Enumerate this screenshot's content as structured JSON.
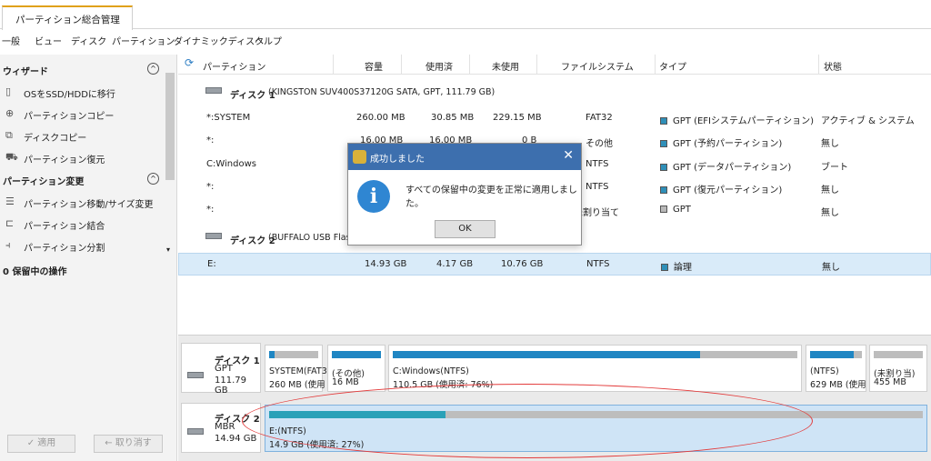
{
  "app_tab": "パーティション総合管理",
  "menu": [
    "一般",
    "ビュー",
    "ディスク",
    "パーティション",
    "ダイナミックディスク",
    "ヘルプ"
  ],
  "sidebar": {
    "wizard_title": "ウィザード",
    "wizard_items": [
      "OSをSSD/HDDに移行",
      "パーティションコピー",
      "ディスクコピー",
      "パーティション復元"
    ],
    "partition_title": "パーティション変更",
    "partition_items": [
      "パーティション移動/サイズ変更",
      "パーティション結合",
      "パーティション分割"
    ],
    "pending": "0 保留中の操作",
    "apply": "✓ 適用",
    "undo": "← 取り消す"
  },
  "table": {
    "headers": [
      "パーティション",
      "容量",
      "使用済",
      "未使用",
      "ファイルシステム",
      "タイプ",
      "状態"
    ],
    "disk1_label": "ディスク 1",
    "disk1_info": "(KINGSTON SUV400S37120G SATA, GPT, 111.79 GB)",
    "disk1_rows": [
      {
        "name": "*:SYSTEM",
        "size": "260.00 MB",
        "used": "30.85 MB",
        "free": "229.15 MB",
        "fs": "FAT32",
        "type": "GPT (EFIシステムパーティション)",
        "status": "アクティブ & システム"
      },
      {
        "name": "*:",
        "size": "16.00 MB",
        "used": "16.00 MB",
        "free": "0 B",
        "fs": "その他",
        "type": "GPT (予約パーティション)",
        "status": "無し"
      },
      {
        "name": "C:Windows",
        "size": "",
        "used": "",
        "free": "",
        "fs": "NTFS",
        "type": "GPT (データパーティション)",
        "status": "ブート"
      },
      {
        "name": "*:",
        "size": "",
        "used": "",
        "free": "",
        "fs": "NTFS",
        "type": "GPT (復元パーティション)",
        "status": "無し"
      },
      {
        "name": "*:",
        "size": "",
        "used": "",
        "free": "",
        "fs": "未割り当て",
        "type": "GPT",
        "status": "無し"
      }
    ],
    "disk2_label": "ディスク 2",
    "disk2_info": "(BUFFALO USB Flas",
    "disk2_row": {
      "name": "E:",
      "size": "14.93 GB",
      "used": "4.17 GB",
      "free": "10.76 GB",
      "fs": "NTFS",
      "type": "論理",
      "status": "無し"
    }
  },
  "map": {
    "disk1": {
      "name": "ディスク 1",
      "kind": "GPT",
      "size": "111.79 GB",
      "parts": [
        {
          "l1": "SYSTEM(FAT3",
          "l2": "260 MB (使用",
          "fill": 0.12
        },
        {
          "l1": "(その他)",
          "l2": "16 MB",
          "fill": 1.0
        },
        {
          "l1": "C:Windows(NTFS)",
          "l2": "110.5 GB (使用済: 76%)",
          "fill": 0.76
        },
        {
          "l1": "(NTFS)",
          "l2": "629 MB (使用",
          "fill": 0.85
        },
        {
          "l1": "(未割り当)",
          "l2": "455 MB",
          "fill": 0.0
        }
      ]
    },
    "disk2": {
      "name": "ディスク 2",
      "kind": "MBR",
      "size": "14.94 GB",
      "part": {
        "l1": "E:(NTFS)",
        "l2": "14.9 GB (使用済: 27%)",
        "fill": 0.27
      }
    }
  },
  "dialog": {
    "title": "成功しました",
    "close": "✕",
    "icon": "i",
    "message": "すべての保留中の変更を正常に適用しました。",
    "ok": "OK"
  },
  "colors": {
    "accent": "#1f86c3",
    "dialog_title": "#3d6fae",
    "annotation": "#e33b3b"
  }
}
